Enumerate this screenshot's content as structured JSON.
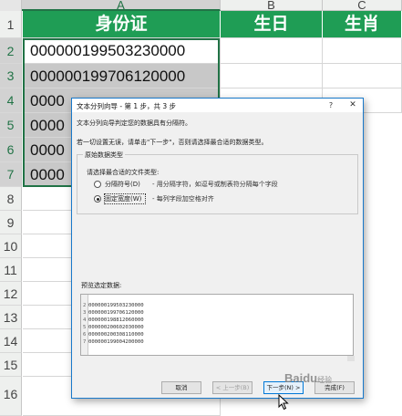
{
  "spreadsheet": {
    "column_headers": [
      "A",
      "B",
      "C"
    ],
    "row_numbers": [
      "1",
      "2",
      "3",
      "4",
      "5",
      "6",
      "7",
      "8",
      "9",
      "10",
      "11",
      "12",
      "13",
      "14",
      "15",
      "16"
    ],
    "header_cells": [
      "身份证",
      "生日",
      "生肖"
    ],
    "id_values": [
      "000000199503230000",
      "000000199706120000",
      "0000",
      "0000",
      "0000",
      "0000"
    ],
    "header_fill_color": "#1f9d55",
    "selection_color": "#217346"
  },
  "dialog": {
    "title": "文本分列向导 - 第 1 步，共 3 步",
    "help_glyph": "?",
    "close_glyph": "✕",
    "intro_line1": "文本分列向导判定您的数据具有分隔符。",
    "intro_line2": "若一切设置无误，请单击\"下一步\"，否则请选择最合适的数据类型。",
    "group_title": "原始数据类型",
    "group_prompt": "请选择最合适的文件类型:",
    "options": [
      {
        "label": "分隔符号(D)",
        "description": "- 用分隔字符，如逗号或制表符分隔每个字段",
        "selected": false
      },
      {
        "label": "固定宽度(W)",
        "description": "- 每列字段加空格对齐",
        "selected": true
      }
    ],
    "preview_label": "预览选定数据:",
    "preview_rows": [
      {
        "num": "2",
        "text": "000000199503230000"
      },
      {
        "num": "3",
        "text": "000000199706120000"
      },
      {
        "num": "4",
        "text": "000000198812060000"
      },
      {
        "num": "5",
        "text": "000000200602030000"
      },
      {
        "num": "6",
        "text": "000000200308110000"
      },
      {
        "num": "7",
        "text": "000000199004200000"
      }
    ],
    "buttons": {
      "cancel": "取消",
      "back": "< 上一步(B)",
      "next": "下一步(N) >",
      "finish": "完成(F)"
    }
  },
  "watermark": {
    "main": "Baidu",
    "sub": "经验"
  }
}
